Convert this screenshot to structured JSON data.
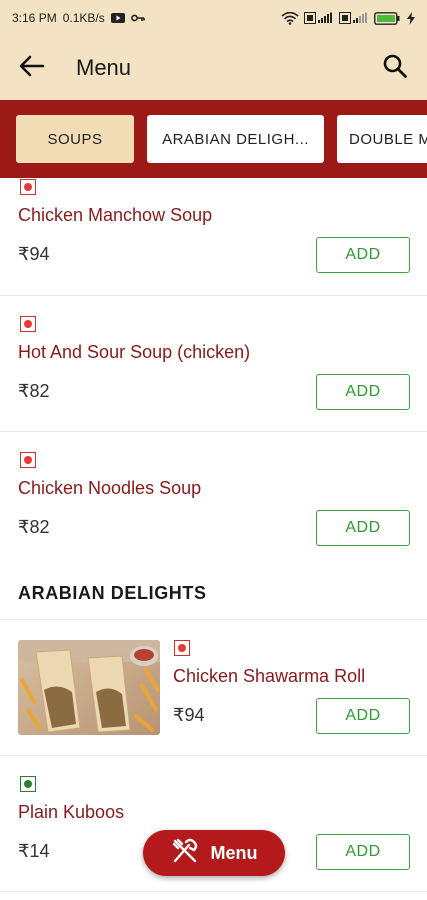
{
  "status_bar": {
    "time": "3:16 PM",
    "speed": "0.1KB/s"
  },
  "app_bar": {
    "title": "Menu",
    "back_icon": "arrow-left-icon",
    "search_icon": "search-icon"
  },
  "categories": [
    {
      "label": "SOUPS",
      "active": true
    },
    {
      "label": "ARABIAN DELIGH...",
      "active": false
    },
    {
      "label": "DOUBLE M",
      "active": false
    }
  ],
  "sections": [
    {
      "title": "",
      "items": [
        {
          "name": "Chicken Manchow Soup",
          "price": "₹94",
          "type": "non-veg",
          "add_label": "ADD"
        },
        {
          "name": "Hot And Sour Soup (chicken)",
          "price": "₹82",
          "type": "non-veg",
          "add_label": "ADD"
        },
        {
          "name": "Chicken Noodles Soup",
          "price": "₹82",
          "type": "non-veg",
          "add_label": "ADD"
        }
      ]
    },
    {
      "title": "ARABIAN DELIGHTS",
      "items": [
        {
          "name": "Chicken Shawarma Roll",
          "price": "₹94",
          "type": "non-veg",
          "add_label": "ADD",
          "has_image": true
        },
        {
          "name": "Plain Kuboos",
          "price": "₹14",
          "type": "veg",
          "add_label": "ADD"
        }
      ]
    }
  ],
  "fab": {
    "label": "Menu",
    "icon": "fork-knife-icon"
  },
  "colors": {
    "header_bg": "#f3e2c3",
    "category_bar_bg": "#9b1a18",
    "item_name": "#8a1a1a",
    "add_green": "#3aa63a",
    "fab_red": "#b4191b"
  }
}
